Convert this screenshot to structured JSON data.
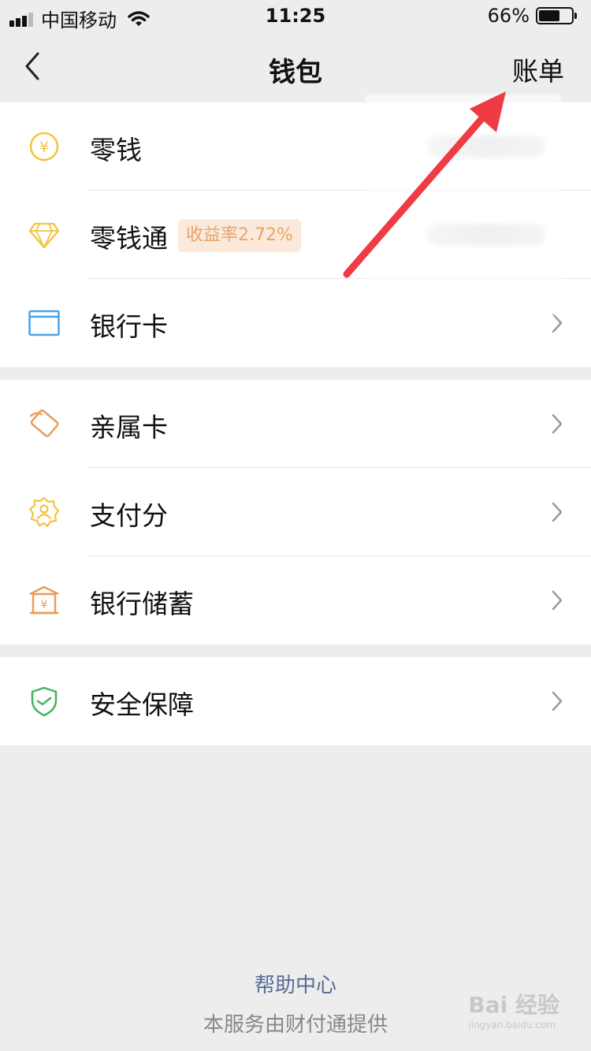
{
  "status_bar": {
    "carrier": "中国移动",
    "time": "11:25",
    "battery_percent": "66%",
    "battery_level": 0.66
  },
  "nav": {
    "title": "钱包",
    "bill_label": "账单",
    "back_icon": "chevron-left-icon"
  },
  "groups": [
    {
      "items": [
        {
          "label": "零钱",
          "icon": "yuan-coin-icon",
          "color": "#f3c33c"
        },
        {
          "label": "零钱通",
          "icon": "diamond-icon",
          "color": "#f3c33c",
          "badge": "收益率2.72%"
        },
        {
          "label": "银行卡",
          "icon": "bank-card-icon",
          "color": "#4aa3e8"
        }
      ]
    },
    {
      "items": [
        {
          "label": "亲属卡",
          "icon": "family-card-icon",
          "color": "#ec9b57"
        },
        {
          "label": "支付分",
          "icon": "pay-score-icon",
          "color": "#f3c33c"
        },
        {
          "label": "银行储蓄",
          "icon": "bank-savings-icon",
          "color": "#ec9b57"
        }
      ]
    },
    {
      "items": [
        {
          "label": "安全保障",
          "icon": "shield-icon",
          "color": "#3fb65b"
        }
      ]
    }
  ],
  "footer": {
    "help_label": "帮助中心",
    "provider_text": "本服务由财付通提供"
  },
  "watermark": {
    "text": "Bai 经验",
    "url": "jingyan.baidu.com"
  },
  "colors": {
    "annotation_arrow": "#ee3b44",
    "link": "#576b95",
    "badge_bg": "#fbeadb",
    "badge_text": "#e8a36a"
  }
}
